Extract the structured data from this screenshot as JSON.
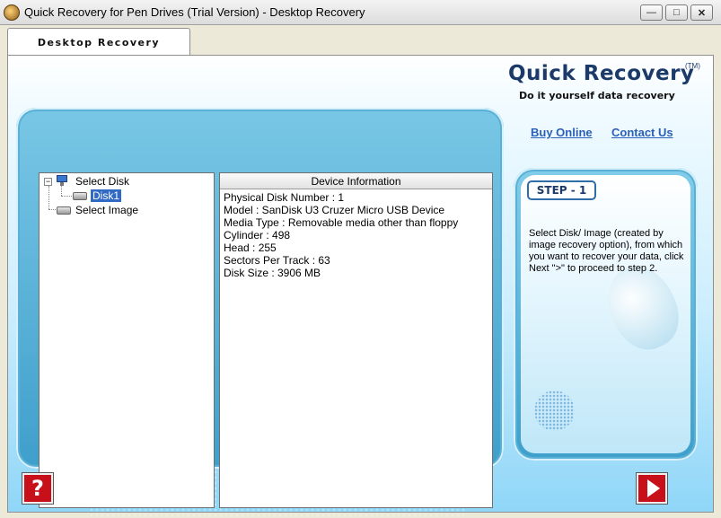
{
  "window": {
    "title": "Quick Recovery for Pen Drives (Trial Version) - Desktop Recovery",
    "controls": {
      "minimize": "minimize-icon",
      "maximize": "maximize-icon",
      "close": "close-icon"
    }
  },
  "tabs": [
    {
      "label": "Desktop Recovery",
      "active": true
    }
  ],
  "logo": {
    "title": "Quick Recovery",
    "tm": "(TM)",
    "tagline": "Do it yourself data recovery"
  },
  "links": {
    "buy_online": "Buy Online",
    "contact_us": "Contact Us"
  },
  "tree": {
    "root": {
      "label": "Select Disk",
      "icon": "computer-icon",
      "expanded": true
    },
    "children": [
      {
        "label": "Disk1",
        "icon": "disk-drive-icon",
        "selected": true
      }
    ],
    "image": {
      "label": "Select Image",
      "icon": "disk-image-icon"
    }
  },
  "device_info": {
    "header": "Device Information",
    "lines": [
      "Physical Disk Number : 1",
      "Model   : SanDisk U3 Cruzer Micro USB Device",
      "Media Type   : Removable media other than floppy",
      "Cylinder   : 498",
      "Head   : 255",
      "Sectors Per Track   : 63",
      "Disk Size  : 3906 MB"
    ]
  },
  "step": {
    "badge": "STEP - 1",
    "instructions": "Select  Disk/ Image  (created by image recovery option),  from  which you want to recover your data,  click  Next \">\" to proceed to step 2."
  },
  "buttons": {
    "help": "?",
    "next_icon": "next-arrow-icon",
    "help_icon": "help-icon"
  },
  "colors": {
    "accent": "#1b3a6a",
    "link": "#2a5fb8",
    "button_red": "#c8101b",
    "selection": "#316ac5"
  }
}
